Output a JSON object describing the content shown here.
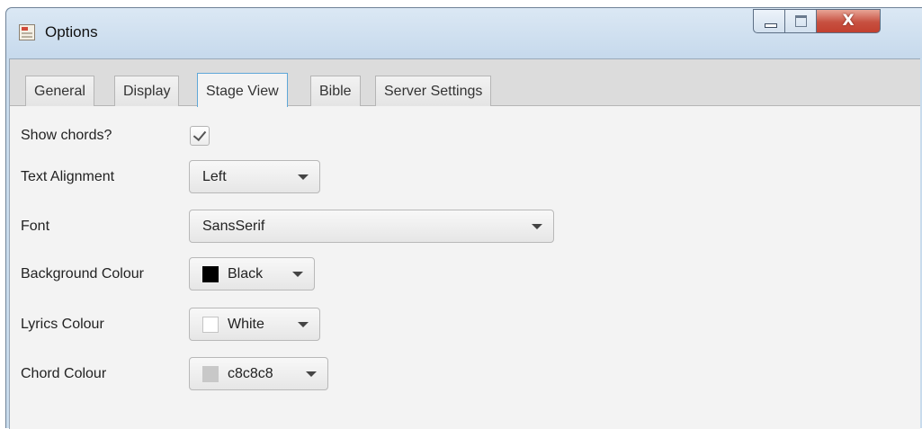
{
  "window": {
    "title": "Options",
    "controls": {
      "minimize_icon": "minimize-icon",
      "maximize_icon": "maximize-icon",
      "close_glyph": "X"
    }
  },
  "tabs": [
    {
      "label": "General",
      "active": false
    },
    {
      "label": "Display",
      "active": false
    },
    {
      "label": "Stage View",
      "active": true
    },
    {
      "label": "Bible",
      "active": false
    },
    {
      "label": "Server Settings",
      "active": false
    }
  ],
  "stage_view": {
    "show_chords": {
      "label": "Show chords?",
      "checked": true
    },
    "text_alignment": {
      "label": "Text Alignment",
      "value": "Left"
    },
    "font": {
      "label": "Font",
      "value": "SansSerif"
    },
    "background_colour": {
      "label": "Background Colour",
      "value": "Black",
      "swatch": "#000000"
    },
    "lyrics_colour": {
      "label": "Lyrics Colour",
      "value": "White",
      "swatch": "#ffffff"
    },
    "chord_colour": {
      "label": "Chord Colour",
      "value": "c8c8c8",
      "swatch": "#c8c8c8"
    }
  },
  "colors": {
    "active_tab_border": "#5fa8d8",
    "close_button": "#c75040",
    "content_background": "#f3f3f3"
  }
}
